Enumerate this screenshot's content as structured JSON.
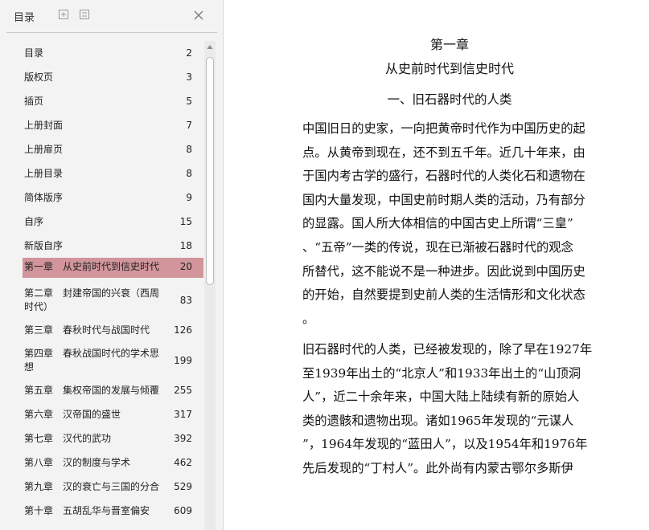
{
  "toc_panel": {
    "title": "目录",
    "items": [
      {
        "label": "目录",
        "page": "2"
      },
      {
        "label": "版权页",
        "page": "3"
      },
      {
        "label": "插页",
        "page": "5"
      },
      {
        "label": "上册封面",
        "page": "7"
      },
      {
        "label": "上册扉页",
        "page": "8"
      },
      {
        "label": "上册目录",
        "page": "8"
      },
      {
        "label": "简体版序",
        "page": "9"
      },
      {
        "label": "自序",
        "page": "15"
      },
      {
        "label": "新版自序",
        "page": "18"
      },
      {
        "label": "第一章　从史前时代到信史时代",
        "page": "20",
        "active": true
      },
      {
        "label": "第二章　封建帝国的兴衰（西周时代）",
        "page": "83"
      },
      {
        "label": "第三章　春秋时代与战国时代",
        "page": "126"
      },
      {
        "label": "第四章　春秋战国时代的学术思想",
        "page": "199"
      },
      {
        "label": "第五章　集权帝国的发展与倾覆",
        "page": "255"
      },
      {
        "label": "第六章　汉帝国的盛世",
        "page": "317"
      },
      {
        "label": "第七章　汉代的武功",
        "page": "392"
      },
      {
        "label": "第八章　汉的制度与学术",
        "page": "462"
      },
      {
        "label": "第九章　汉的衰亡与三国的分合",
        "page": "529"
      },
      {
        "label": "第十章　五胡乱华与晋室偏安",
        "page": "609"
      }
    ]
  },
  "document": {
    "chapter_title": "第一章",
    "chapter_subtitle": "从史前时代到信史时代",
    "section_title": "一、旧石器时代的人类",
    "paragraph1_lines": [
      "中国旧日的史家，一向把黄帝时代作为中国历史的起",
      "点。从黄帝到现在，还不到五千年。近几十年来，由",
      "于国内考古学的盛行，石器时代的人类化石和遗物在",
      "国内大量发现，中国史前时期人类的活动，乃有部分",
      "的显露。国人所大体相信的中国古史上所谓“三皇”",
      "、“五帝”一类的传说，现在已渐被石器时代的观念",
      "所替代，这不能说不是一种进步。因此说到中国历史",
      "的开始，自然要提到史前人类的生活情形和文化状态",
      "。"
    ],
    "paragraph2_lines": [
      "旧石器时代的人类，已经被发现的，除了早在1927年",
      "至1939年出土的“北京人”和1933年出土的“山顶洞",
      "人”，近二十余年来，中国大陆上陆续有新的原始人",
      "类的遗骸和遗物出现。诸如1965年发现的“元谋人",
      "”，1964年发现的“蓝田人”，以及1954年和1976年",
      "先后发现的“丁村人”。此外尚有内蒙古鄂尔多斯伊"
    ]
  },
  "colors": {
    "panel_bg": "#f3f3f3",
    "active_item_bg": "#d1959b"
  }
}
